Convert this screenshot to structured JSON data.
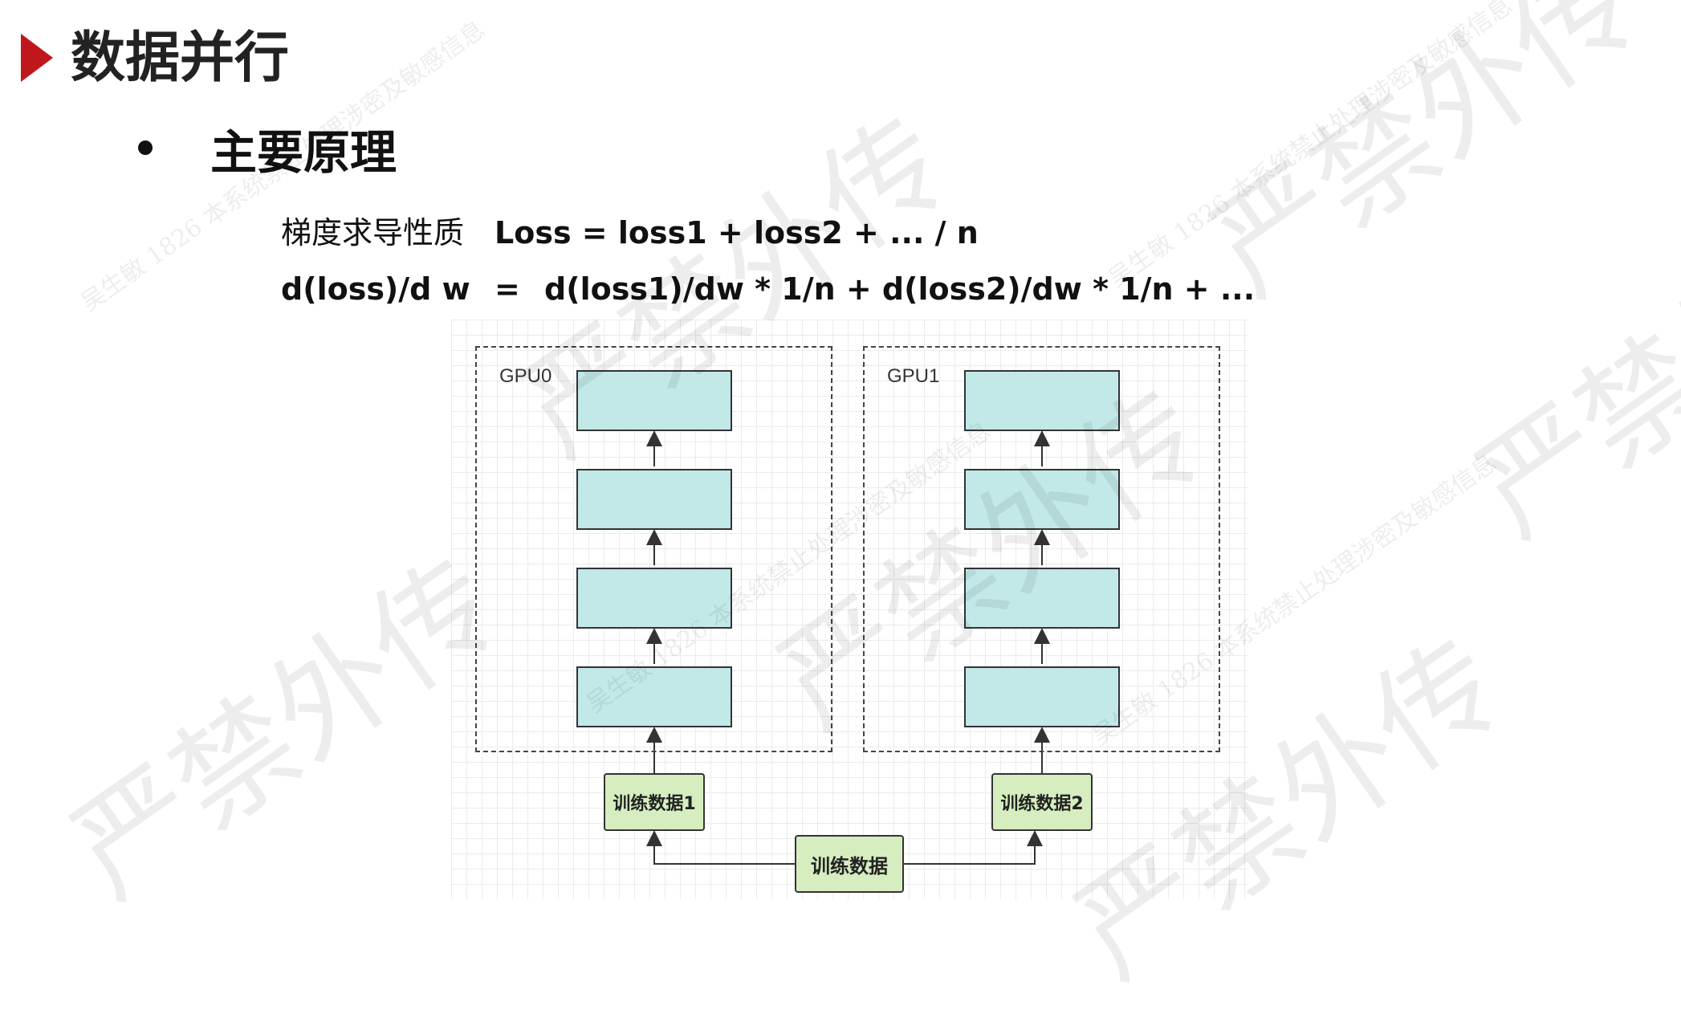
{
  "title": "数据并行",
  "subtitle": "主要原理",
  "formula": {
    "line1_label": "梯度求导性质",
    "line1_expr": "Loss = loss1 + loss2 + ... / n",
    "line2_lhs": "d(loss)/d w",
    "line2_eq": "=",
    "line2_rhs": "d(loss1)/dw * 1/n + d(loss2)/dw * 1/n + ..."
  },
  "diagram": {
    "gpus": [
      {
        "label": "GPU0",
        "layers": 4,
        "data_label": "训练数据1"
      },
      {
        "label": "GPU1",
        "layers": 4,
        "data_label": "训练数据2"
      }
    ],
    "source_label": "训练数据"
  },
  "watermark": {
    "big": "严禁外传",
    "small": "吴生敏 1826 本系统禁止处理涉密及敏感信息"
  },
  "colors": {
    "accent": "#c0171d",
    "layer_fill": "#c2e8e8",
    "data_fill": "#d6edc0"
  }
}
